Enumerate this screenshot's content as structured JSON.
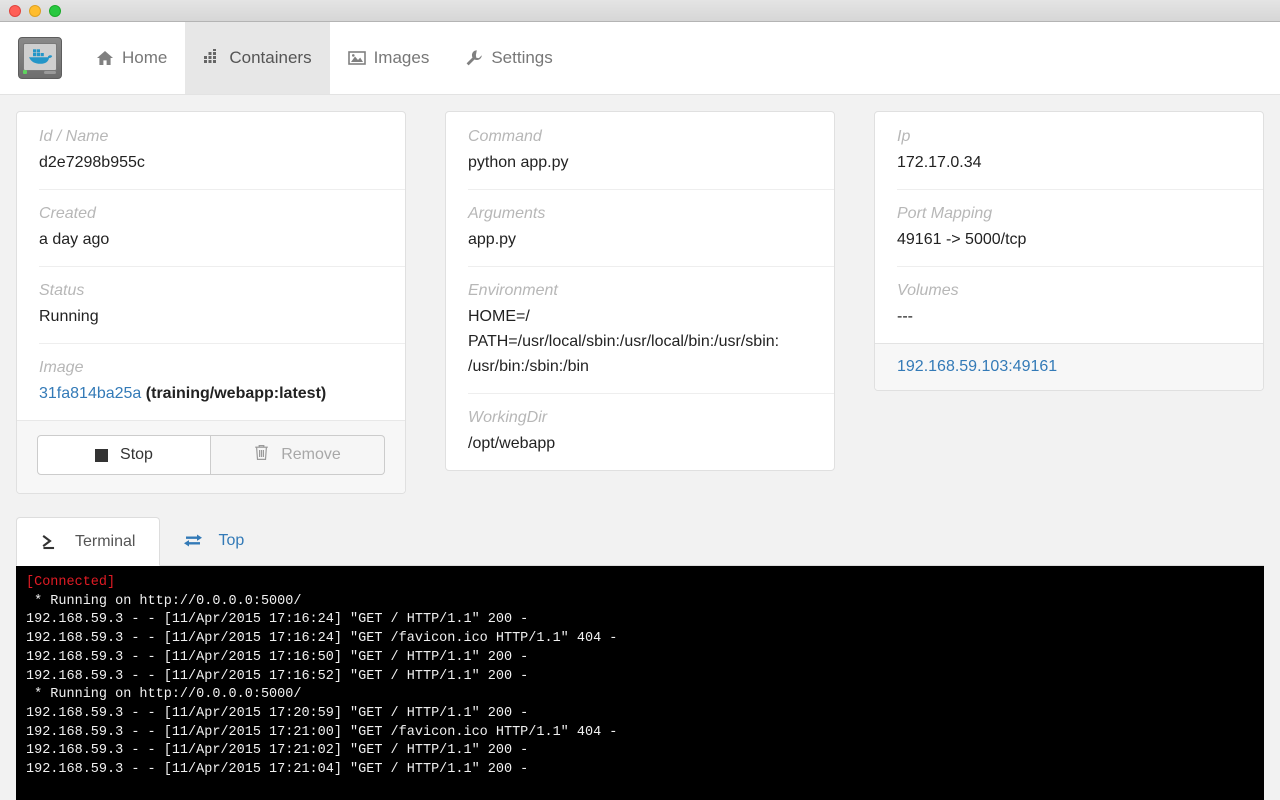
{
  "titlebar": {
    "lights": [
      "close",
      "minimize",
      "zoom"
    ]
  },
  "nav": {
    "brand_icon": "docker-whale-monitor-logo",
    "items": [
      {
        "label": "Home",
        "icon": "home-icon",
        "active": false
      },
      {
        "label": "Containers",
        "icon": "grid-icon",
        "active": true
      },
      {
        "label": "Images",
        "icon": "picture-icon",
        "active": false
      },
      {
        "label": "Settings",
        "icon": "wrench-icon",
        "active": false
      }
    ]
  },
  "left_panel": {
    "rows": [
      {
        "label": "Id / Name",
        "value": "d2e7298b955c"
      },
      {
        "label": "Created",
        "value": "a day ago"
      },
      {
        "label": "Status",
        "value": "Running"
      }
    ],
    "image_row": {
      "label": "Image",
      "link": "31fa814ba25a",
      "tag": "(training/webapp:latest)"
    },
    "buttons": [
      {
        "label": "Stop",
        "icon": "stop-square-icon",
        "enabled": true
      },
      {
        "label": "Remove",
        "icon": "trash-icon",
        "enabled": false
      }
    ]
  },
  "mid_panel": {
    "rows": [
      {
        "label": "Command",
        "value": "python app.py"
      },
      {
        "label": "Arguments",
        "value": "app.py"
      }
    ],
    "environment": {
      "label": "Environment",
      "lines": [
        "HOME=/",
        "PATH=/usr/local/sbin:/usr/local/bin:/usr/sbin:",
        "/usr/bin:/sbin:/bin"
      ]
    },
    "workingdir": {
      "label": "WorkingDir",
      "value": "/opt/webapp"
    }
  },
  "right_panel": {
    "rows": [
      {
        "label": "Ip",
        "value": "172.17.0.34"
      },
      {
        "label": "Port Mapping",
        "value": "49161 -> 5000/tcp"
      },
      {
        "label": "Volumes",
        "value": "---"
      }
    ],
    "footer_link": "192.168.59.103:49161"
  },
  "terminal_panel": {
    "tabs": [
      {
        "label": "Terminal",
        "icon": "prompt-icon",
        "active": true
      },
      {
        "label": "Top",
        "icon": "exchange-icon",
        "active": false
      }
    ],
    "connected_marker": "[Connected]",
    "lines": [
      " * Running on http://0.0.0.0:5000/",
      "192.168.59.3 - - [11/Apr/2015 17:16:24] \"GET / HTTP/1.1\" 200 -",
      "192.168.59.3 - - [11/Apr/2015 17:16:24] \"GET /favicon.ico HTTP/1.1\" 404 -",
      "192.168.59.3 - - [11/Apr/2015 17:16:50] \"GET / HTTP/1.1\" 200 -",
      "192.168.59.3 - - [11/Apr/2015 17:16:52] \"GET / HTTP/1.1\" 200 -",
      " * Running on http://0.0.0.0:5000/",
      "192.168.59.3 - - [11/Apr/2015 17:20:59] \"GET / HTTP/1.1\" 200 -",
      "192.168.59.3 - - [11/Apr/2015 17:21:00] \"GET /favicon.ico HTTP/1.1\" 404 -",
      "192.168.59.3 - - [11/Apr/2015 17:21:02] \"GET / HTTP/1.1\" 200 -",
      "192.168.59.3 - - [11/Apr/2015 17:21:04] \"GET / HTTP/1.1\" 200 -"
    ]
  },
  "colors": {
    "link": "#337ab7",
    "page_bg": "#f2f2f2",
    "terminal_bg": "#000000",
    "terminal_fg": "#f0f0f0",
    "connected_red": "#e01b24",
    "active_tab_bg": "#e7e7e7"
  }
}
